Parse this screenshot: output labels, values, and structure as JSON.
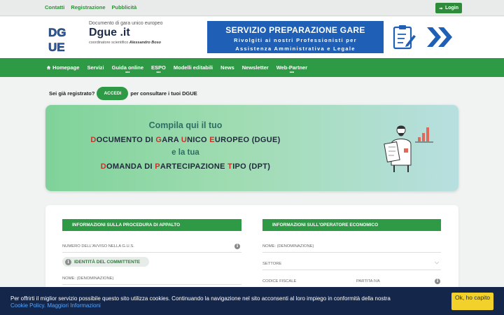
{
  "topbar": {
    "links": [
      "Contatti",
      "Registrazione",
      "Pubblicità"
    ],
    "login_label": "Login"
  },
  "brand": {
    "subtitle": "Documento di gara unico europeo",
    "name": "Dgue .it",
    "coordinator_prefix": "coordinatore scientifico",
    "coordinator_name": "Alessandro Boso"
  },
  "banner": {
    "title": "SERVIZIO PREPARAZIONE GARE",
    "line1": "Rivolgiti ai nostri Professionisti per",
    "line2": "Assistenza Amministrativa e Legale"
  },
  "nav": {
    "items": [
      {
        "label": "Homepage",
        "icon": "home-icon",
        "has_dropdown": false
      },
      {
        "label": "Servizi",
        "has_dropdown": false
      },
      {
        "label": "Guida online",
        "has_dropdown": true
      },
      {
        "label": "ESPO",
        "has_dropdown": true
      },
      {
        "label": "Modelli editabili",
        "has_dropdown": false
      },
      {
        "label": "News",
        "has_dropdown": false
      },
      {
        "label": "Newsletter",
        "has_dropdown": false
      },
      {
        "label": "Web-Partner",
        "has_dropdown": true
      }
    ]
  },
  "prompt": {
    "before": "Sei già registrato?",
    "button": "ACCEDI",
    "after": "per consultare i tuoi DGUE"
  },
  "hero": {
    "line1": "Compila qui il tuo",
    "line2": "Documento di Gara Unico Europeo (DGUE)",
    "line3": "e la tua",
    "line4": "Domanda di Partecipazione Tipo (DPT)"
  },
  "form": {
    "left_header": "INFORMAZIONI SULLA PROCEDURA DI APPALTO",
    "right_header": "INFORMAZIONI SULL'OPERATORE ECONOMICO",
    "left_fields": {
      "notice_number": "NUMERO DELL'AVVISO NELLA G.U.S.",
      "committente_pill": "IDENTITÀ DEL COMMITTENTE",
      "name": "NOME: (DENOMINAZIONE)"
    },
    "right_fields": {
      "name": "NOME: (DENOMINAZIONE)",
      "sector": "SETTORE",
      "tax_code": "CODICE FISCALE",
      "vat": "PARTITA IVA"
    }
  },
  "cookie": {
    "text": "Per offrirti il miglior servizio possibile questo sito utilizza cookies. Continuando la navigazione nel sito acconsenti al loro impiego in conformità della nostra",
    "link1": "Cookie Policy.",
    "link2": "Maggiori Informazioni",
    "button": "Ok, ho capito"
  },
  "colors": {
    "green": "#2f9a45",
    "banner_blue": "#1f5fb5",
    "cookie_bg": "#14264a",
    "ok_yellow": "#f2d12b",
    "accent_red": "#c8312a"
  }
}
